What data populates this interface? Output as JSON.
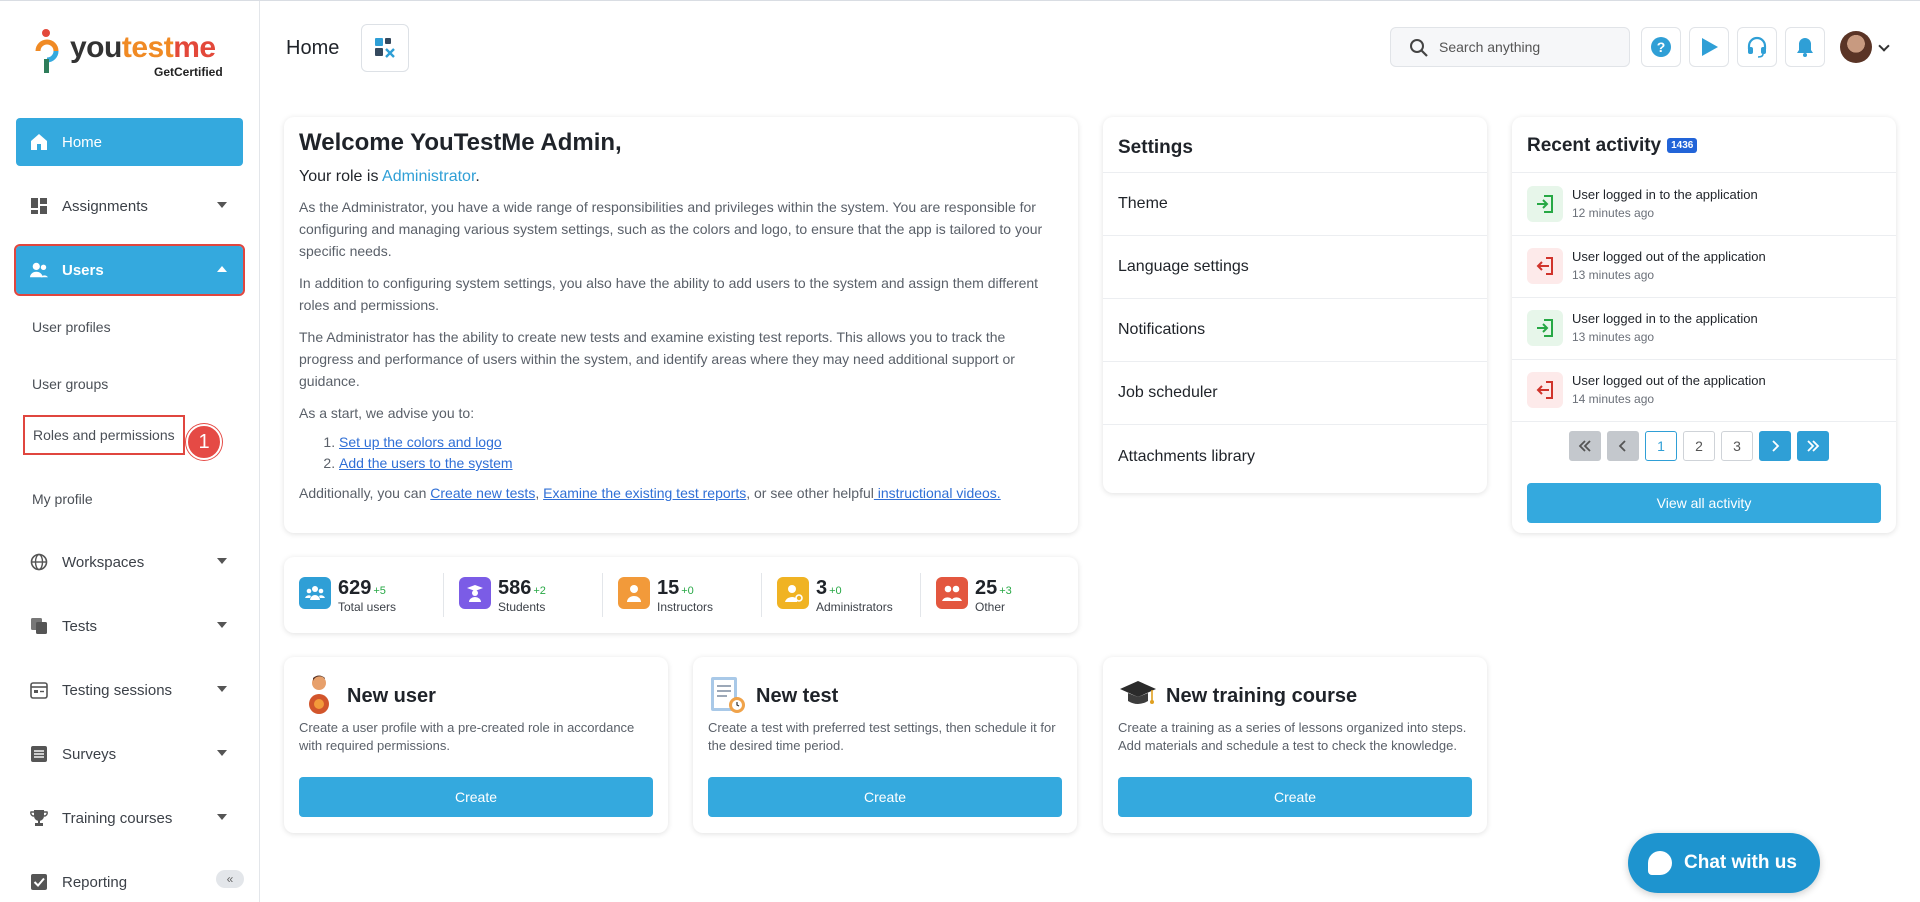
{
  "brand": {
    "name_part1": "you",
    "name_part2": "test",
    "name_part3": "me",
    "sub": "GetCertified"
  },
  "sidebar": {
    "items": [
      {
        "label": "Home"
      },
      {
        "label": "Assignments"
      },
      {
        "label": "Users"
      },
      {
        "label": "Workspaces"
      },
      {
        "label": "Tests"
      },
      {
        "label": "Testing sessions"
      },
      {
        "label": "Surveys"
      },
      {
        "label": "Training courses"
      },
      {
        "label": "Reporting"
      }
    ],
    "users_sub": [
      "User profiles",
      "User groups",
      "Roles and permissions",
      "My profile"
    ],
    "step_badge": "1",
    "collapse_label": "«"
  },
  "header": {
    "title": "Home",
    "search_placeholder": "Search anything"
  },
  "welcome": {
    "title": "Welcome YouTestMe Admin,",
    "role_prefix": "Your role is ",
    "role": "Administrator",
    "role_suffix": ".",
    "p1": "As the Administrator, you have a wide range of responsibilities and privileges within the system. You are responsible for configuring and managing various system settings, such as the colors and logo, to ensure that the app is tailored to your specific needs.",
    "p2": "In addition to configuring system settings, you also have the ability to add users to the system and assign them different roles and permissions.",
    "p3": "The Administrator has the ability to create new tests and examine existing test reports. This allows you to track the progress and performance of users within the system, and identify areas where they may need additional support or guidance.",
    "p4": "As a start, we advise you to:",
    "steps": [
      "Set up the colors and logo",
      "Add the users to the system"
    ],
    "final_prefix": "Additionally, you can ",
    "final_link1": "Create new tests",
    "final_sep": ", ",
    "final_link2": "Examine the existing test reports",
    "final_mid": ", or see other helpful",
    "final_link3": " instructional videos."
  },
  "stats": [
    {
      "value": "629",
      "delta": "+5",
      "label": "Total users",
      "color": "#2f9fd6"
    },
    {
      "value": "586",
      "delta": "+2",
      "label": "Students",
      "color": "#7b5ce6"
    },
    {
      "value": "15",
      "delta": "+0",
      "label": "Instructors",
      "color": "#f29a3a"
    },
    {
      "value": "3",
      "delta": "+0",
      "label": "Administrators",
      "color": "#f0b323"
    },
    {
      "value": "25",
      "delta": "+3",
      "label": "Other",
      "color": "#e3573f"
    }
  ],
  "settings": {
    "title": "Settings",
    "items": [
      "Theme",
      "Language settings",
      "Notifications",
      "Job scheduler",
      "Attachments library"
    ]
  },
  "activity": {
    "title": "Recent activity",
    "count": "1436",
    "items": [
      {
        "text": "User logged in to the application",
        "when": "12 minutes ago",
        "kind": "in"
      },
      {
        "text": "User logged out of the application",
        "when": "13 minutes ago",
        "kind": "out"
      },
      {
        "text": "User logged in to the application",
        "when": "13 minutes ago",
        "kind": "in"
      },
      {
        "text": "User logged out of the application",
        "when": "14 minutes ago",
        "kind": "out"
      }
    ],
    "pages": [
      "1",
      "2",
      "3"
    ],
    "view_all": "View all activity"
  },
  "actions": [
    {
      "title": "New user",
      "desc": "Create a user profile with a pre-created role in accordance with required permissions.",
      "button": "Create"
    },
    {
      "title": "New test",
      "desc": "Create a test with preferred test settings, then schedule it for the desired time period.",
      "button": "Create"
    },
    {
      "title": "New training course",
      "desc": "Create a training as a series of lessons organized into steps. Add materials and schedule a test to check the knowledge.",
      "button": "Create"
    }
  ],
  "chat": {
    "label": "Chat with us"
  },
  "colors": {
    "accent": "#34a9de",
    "highlight": "#e0463f"
  }
}
